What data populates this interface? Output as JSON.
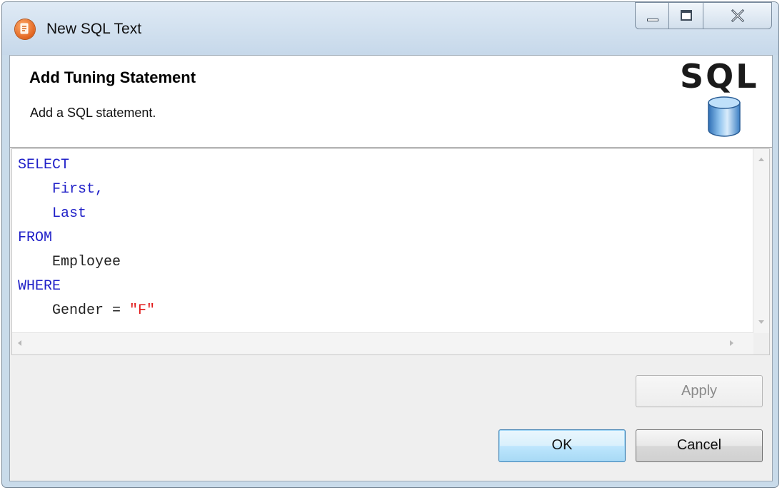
{
  "window": {
    "title": "New SQL Text",
    "controls": [
      "minimize",
      "maximize",
      "close"
    ]
  },
  "header": {
    "title": "Add Tuning Statement",
    "description": "Add a SQL statement.",
    "logo_text": "SQL",
    "logo_icon": "database-cylinder-icon"
  },
  "editor": {
    "lines": [
      {
        "indent": "",
        "tokens": [
          {
            "text": "SELECT",
            "type": "keyword"
          }
        ]
      },
      {
        "indent": "    ",
        "tokens": [
          {
            "text": "First,",
            "type": "keyword"
          }
        ]
      },
      {
        "indent": "    ",
        "tokens": [
          {
            "text": "Last",
            "type": "keyword"
          }
        ]
      },
      {
        "indent": "",
        "tokens": [
          {
            "text": "FROM",
            "type": "keyword"
          }
        ]
      },
      {
        "indent": "    ",
        "tokens": [
          {
            "text": "Employee",
            "type": "plain"
          }
        ]
      },
      {
        "indent": "",
        "tokens": [
          {
            "text": "WHERE",
            "type": "keyword"
          }
        ]
      },
      {
        "indent": "    ",
        "tokens": [
          {
            "text": "Gender = ",
            "type": "plain"
          },
          {
            "text": "\"F\"",
            "type": "string"
          }
        ]
      }
    ],
    "colors": {
      "keyword": "#2020c8",
      "plain": "#222222",
      "string": "#e01818"
    }
  },
  "buttons": {
    "apply": "Apply",
    "ok": "OK",
    "cancel": "Cancel"
  }
}
